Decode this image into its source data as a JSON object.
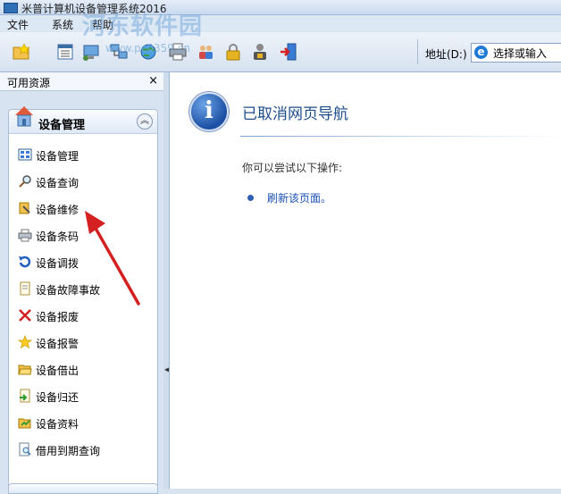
{
  "window": {
    "title": "米普计算机设备管理系统2016"
  },
  "menu": {
    "items": [
      "文件",
      "系统",
      "帮助"
    ]
  },
  "watermark": {
    "text": "河东软件园",
    "sub": "www.pc0359.cn"
  },
  "toolbar": {
    "buttons": [
      "new-icon",
      "list-icon",
      "computer-icon",
      "network-icon",
      "globe-icon",
      "printer-icon",
      "users-icon",
      "lock-icon",
      "user-lock-icon",
      "exit-icon"
    ],
    "address_label": "地址(D:)",
    "address_value": "选择或输入"
  },
  "sidebar": {
    "header": "可用资源",
    "close": "×",
    "group_title": "设备管理",
    "collapse": "︽",
    "items": [
      {
        "label": "设备管理",
        "icon": "grid-icon"
      },
      {
        "label": "设备查询",
        "icon": "magnifier-icon"
      },
      {
        "label": "设备维修",
        "icon": "repair-icon"
      },
      {
        "label": "设备条码",
        "icon": "barcode-printer-icon"
      },
      {
        "label": "设备调拨",
        "icon": "transfer-arrow-icon"
      },
      {
        "label": "设备故障事故",
        "icon": "document-icon"
      },
      {
        "label": "设备报废",
        "icon": "red-x-icon"
      },
      {
        "label": "设备报警",
        "icon": "star-icon"
      },
      {
        "label": "设备借出",
        "icon": "folder-open-icon"
      },
      {
        "label": "设备归还",
        "icon": "return-icon"
      },
      {
        "label": "设备资料",
        "icon": "folder-doc-icon"
      },
      {
        "label": "借用到期查询",
        "icon": "page-search-icon"
      }
    ]
  },
  "content": {
    "heading": "已取消网页导航",
    "subtext": "你可以尝试以下操作:",
    "link": "刷新该页面。"
  },
  "colors": {
    "accent": "#1e4e8a",
    "link": "#1a4fb5",
    "arrow": "#d42020"
  }
}
